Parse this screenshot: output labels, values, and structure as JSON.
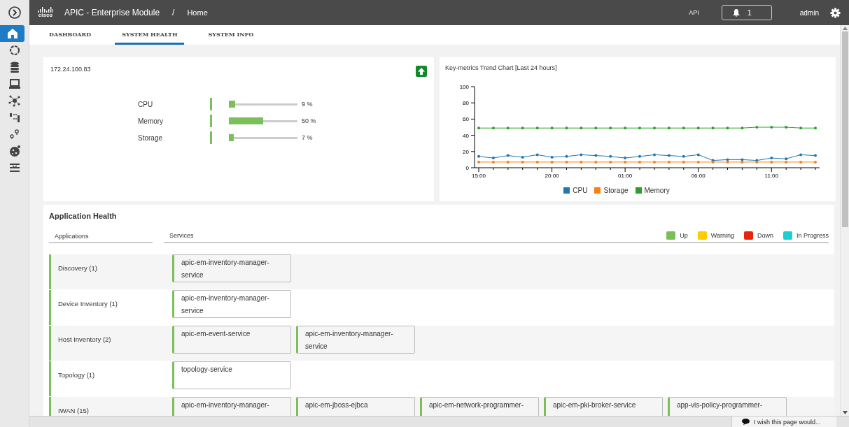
{
  "sidebar": {
    "items": [
      {
        "kind": "toggle",
        "selected": false
      },
      {
        "kind": "home",
        "selected": true
      },
      {
        "kind": "ring",
        "selected": false
      },
      {
        "kind": "database",
        "selected": false
      },
      {
        "kind": "laptop",
        "selected": false
      },
      {
        "kind": "network",
        "selected": false
      },
      {
        "kind": "topology",
        "selected": false
      },
      {
        "kind": "pins",
        "selected": false
      },
      {
        "kind": "cookie",
        "selected": false
      },
      {
        "kind": "sliders",
        "selected": false
      }
    ]
  },
  "header": {
    "logo_text": "cisco",
    "product": "APIC - Enterprise Module",
    "separator": "/",
    "page": "Home",
    "api": "API",
    "notifications": "1",
    "user": "admin"
  },
  "tabs": [
    {
      "label": "DASHBOARD",
      "selected": false
    },
    {
      "label": "SYSTEM HEALTH",
      "selected": true
    },
    {
      "label": "SYSTEM INFO",
      "selected": false
    }
  ],
  "host": {
    "address": "172.24.100.83",
    "metrics": [
      {
        "name": "CPU",
        "level": 0.09,
        "reading": "9 %"
      },
      {
        "name": "Memory",
        "level": 0.5,
        "reading": "50 %"
      },
      {
        "name": "Storage",
        "level": 0.07,
        "reading": "7 %"
      }
    ]
  },
  "trend": {
    "title": "Key-metrics Trend Chart [Last 24 hours]",
    "chart_data": {
      "type": "line",
      "categories": [
        "15:00",
        null,
        null,
        null,
        null,
        "20:00",
        null,
        null,
        null,
        null,
        "01:00",
        null,
        null,
        null,
        null,
        "06:00",
        null,
        null,
        null,
        null,
        "11:00",
        null,
        null,
        null
      ],
      "ylim": [
        0,
        100
      ],
      "yticks": [
        0,
        20,
        40,
        60,
        80,
        100
      ],
      "series": [
        {
          "name": "CPU",
          "color": "#1f77b4",
          "values": [
            14,
            12,
            15,
            13,
            16,
            13,
            14,
            16,
            15,
            14,
            12,
            14,
            16,
            15,
            14,
            16,
            9,
            10,
            10,
            9,
            12,
            11,
            16,
            15
          ]
        },
        {
          "name": "Storage",
          "color": "#ff7f0e",
          "values": [
            7,
            7,
            7,
            7,
            7,
            7,
            7,
            7,
            7,
            7,
            7,
            7,
            7,
            7,
            7,
            7,
            7,
            7,
            7,
            7,
            7,
            7,
            7,
            7
          ]
        },
        {
          "name": "Memory",
          "color": "#2ca02c",
          "values": [
            49,
            49,
            49,
            49,
            49,
            49,
            49,
            49,
            49,
            49,
            49,
            49,
            49,
            49,
            49,
            49,
            49,
            49,
            49,
            50,
            50,
            50,
            49,
            49
          ]
        }
      ]
    }
  },
  "app_health": {
    "title": "Application Health",
    "columns": [
      "Applications",
      "Services"
    ],
    "legend": [
      {
        "label": "Up",
        "color": "#7cbf5a"
      },
      {
        "label": "Warning",
        "color": "#ffcc00"
      },
      {
        "label": "Down",
        "color": "#e8250c"
      },
      {
        "label": "In Progress",
        "color": "#1ccfd0"
      }
    ],
    "rows": [
      {
        "name": "Discovery (1)",
        "color": "#7cbf5a",
        "services": [
          {
            "name": "apic-em-inventory-manager-service",
            "color": "#7cbf5a"
          }
        ]
      },
      {
        "name": "Device Inventory (1)",
        "color": "#7cbf5a",
        "services": [
          {
            "name": "apic-em-inventory-manager-service",
            "color": "#7cbf5a"
          }
        ]
      },
      {
        "name": "Host Inventory (2)",
        "color": "#7cbf5a",
        "services": [
          {
            "name": "apic-em-event-service",
            "color": "#7cbf5a"
          },
          {
            "name": "apic-em-inventory-manager-service",
            "color": "#7cbf5a"
          }
        ]
      },
      {
        "name": "Topology (1)",
        "color": "#7cbf5a",
        "services": [
          {
            "name": "topology-service",
            "color": "#7cbf5a"
          }
        ]
      },
      {
        "name": "IWAN (15)",
        "color": "#7cbf5a",
        "services": [
          {
            "name": "apic-em-inventory-manager-",
            "color": "#7cbf5a"
          },
          {
            "name": "apic-em-jboss-ejbca",
            "color": "#7cbf5a"
          },
          {
            "name": "apic-em-network-programmer-",
            "color": "#7cbf5a"
          },
          {
            "name": "apic-em-pki-broker-service",
            "color": "#7cbf5a"
          },
          {
            "name": "app-vis-policy-programmer-",
            "color": "#7cbf5a"
          }
        ]
      }
    ]
  },
  "feedback": "I wish this page would..."
}
